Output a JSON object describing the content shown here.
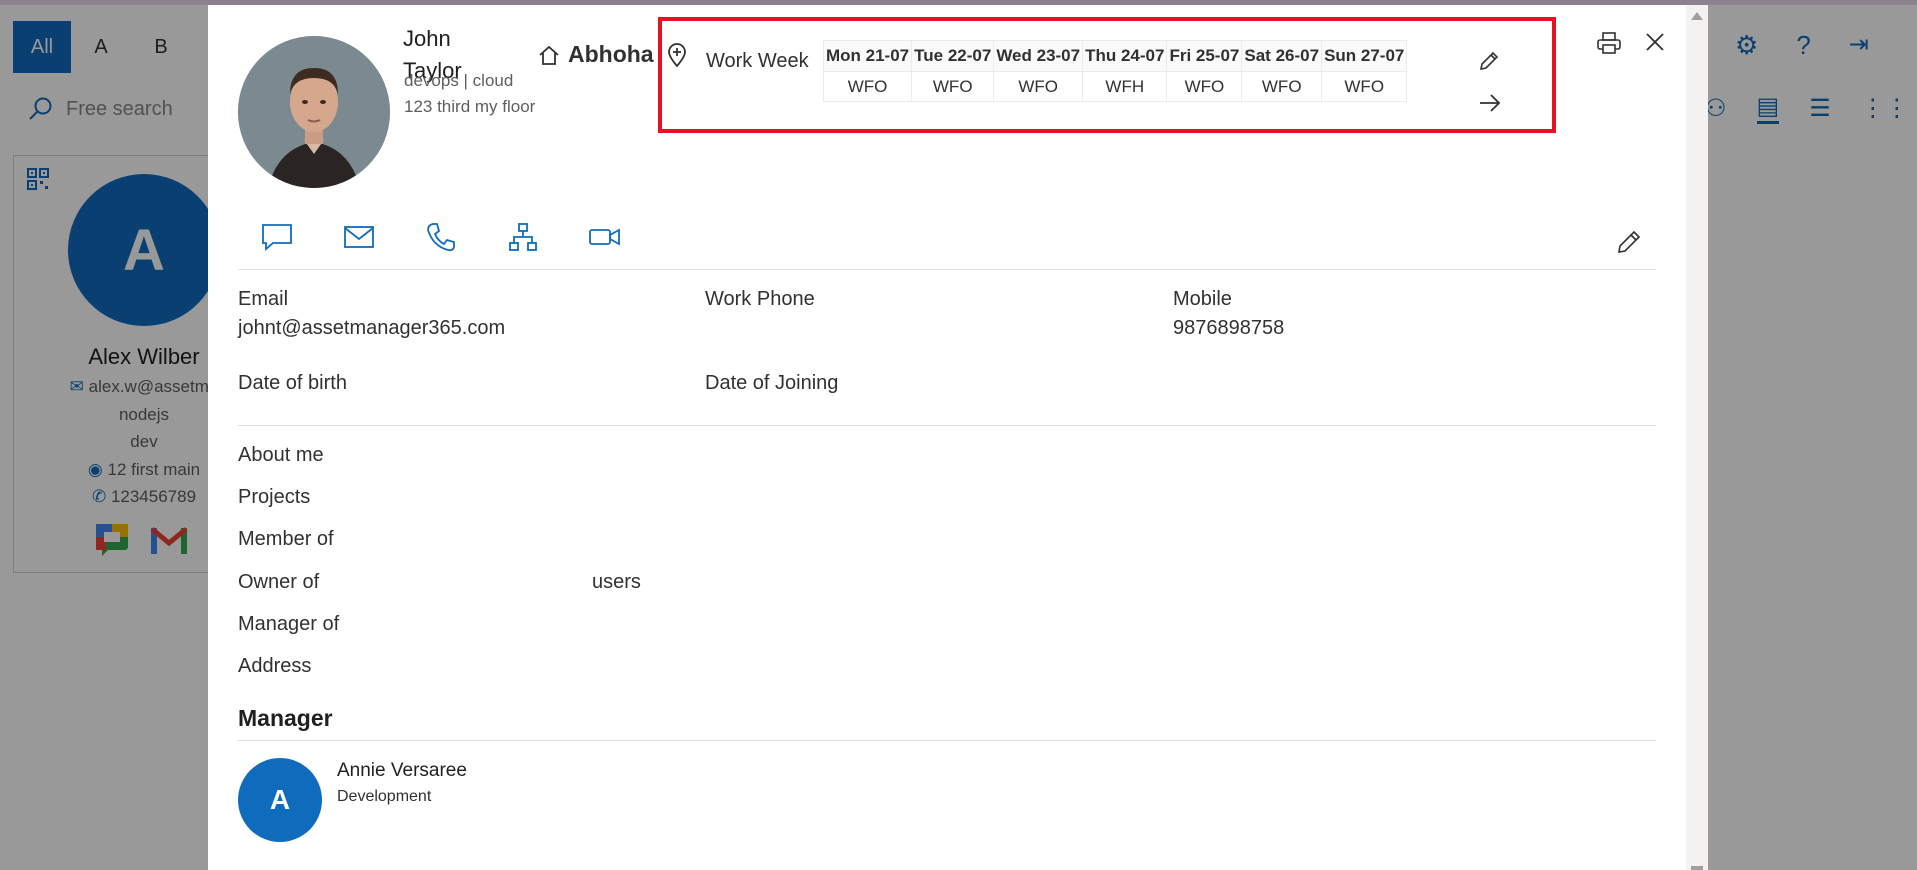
{
  "background": {
    "alpha_filters": [
      {
        "label": "All",
        "active": true
      },
      {
        "label": "A",
        "active": false
      },
      {
        "label": "B",
        "active": false
      }
    ],
    "search_placeholder": "Free search",
    "card": {
      "initial": "A",
      "name": "Alex Wilber",
      "email": "alex.w@assetma",
      "line1": "nodejs",
      "line2": "dev",
      "location": "12 first main",
      "phone": "123456789"
    }
  },
  "profile": {
    "name": "John Taylor",
    "tags": "devops | cloud",
    "address": "123 third my floor",
    "home_location": "Abhoha"
  },
  "work_week": {
    "label": "Work Week",
    "days": [
      {
        "day": "Mon 21-07",
        "status": "WFO"
      },
      {
        "day": "Tue 22-07",
        "status": "WFO"
      },
      {
        "day": "Wed 23-07",
        "status": "WFO"
      },
      {
        "day": "Thu 24-07",
        "status": "WFH"
      },
      {
        "day": "Fri 25-07",
        "status": "WFO"
      },
      {
        "day": "Sat 26-07",
        "status": "WFO"
      },
      {
        "day": "Sun 27-07",
        "status": "WFO"
      }
    ],
    "highlight_color": "#e81123"
  },
  "fields": {
    "email_label": "Email",
    "email_value": "johnt@assetmanager365.com",
    "work_phone_label": "Work Phone",
    "mobile_label": "Mobile",
    "mobile_value": "9876898758",
    "dob_label": "Date of birth",
    "doj_label": "Date of Joining",
    "about_label": "About me",
    "projects_label": "Projects",
    "member_label": "Member of",
    "owner_label": "Owner of",
    "owner_value": "users",
    "manager_of_label": "Manager of",
    "address_label": "Address"
  },
  "manager": {
    "section_title": "Manager",
    "initial": "A",
    "name": "Annie Versaree",
    "department": "Development"
  },
  "colors": {
    "accent": "#0f6cbd"
  }
}
